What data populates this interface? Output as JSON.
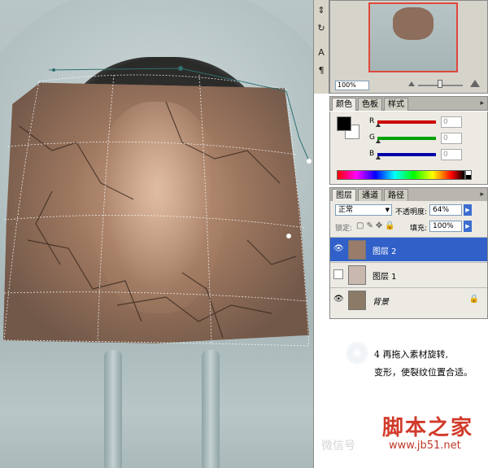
{
  "navigator": {
    "zoom": "100%"
  },
  "color_panel": {
    "tabs": [
      "颜色",
      "色板",
      "样式"
    ],
    "sliders": [
      {
        "label": "R",
        "value": "0",
        "color": "#cc0000"
      },
      {
        "label": "G",
        "value": "0",
        "color": "#00a000"
      },
      {
        "label": "B",
        "value": "0",
        "color": "#0000a8"
      }
    ],
    "foreground": "#000000",
    "background": "#ffffff"
  },
  "layers_panel": {
    "tabs": [
      "图层",
      "通道",
      "路径"
    ],
    "blend_mode": "正常",
    "opacity_label": "不透明度:",
    "opacity_value": "64%",
    "lock_label": "锁定:",
    "fill_label": "填充:",
    "fill_value": "100%",
    "layers": [
      {
        "name": "图层 2",
        "selected": true,
        "visible": true
      },
      {
        "name": "图层 1",
        "selected": false,
        "visible": false
      },
      {
        "name": "背景",
        "selected": false,
        "visible": true,
        "locked": true
      }
    ]
  },
  "caption": {
    "line1": "4 再拖入素材旋转,",
    "line2": "变形，使裂纹位置合适。"
  },
  "watermark": {
    "site_name": "脚本之家",
    "url": "www.jb51.net",
    "wechat": "微信号"
  },
  "accent_colors": {
    "selection": "#3060c8",
    "navigator_frame": "#e0463c",
    "watermark": "#d13a2a"
  }
}
